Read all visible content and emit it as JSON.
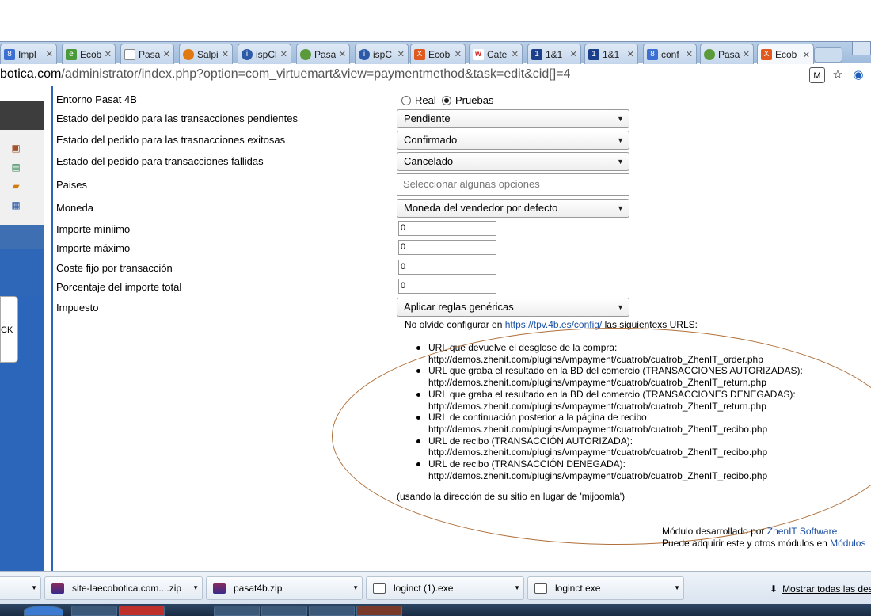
{
  "browser": {
    "tabs": [
      {
        "label": "Impl",
        "icon": "google-icon",
        "color": "#3b6fd1",
        "glyph": "8"
      },
      {
        "label": "Ecob",
        "icon": "eco-icon",
        "color": "#4a9a3a",
        "glyph": "e"
      },
      {
        "label": "Pasa",
        "icon": "page-icon",
        "color": "#999999",
        "glyph": ""
      },
      {
        "label": "Salpi",
        "icon": "fire-icon",
        "color": "#e07a10",
        "glyph": ""
      },
      {
        "label": "ispCl",
        "icon": "isp-icon",
        "color": "#2d5aa8",
        "glyph": "i"
      },
      {
        "label": "Pasa",
        "icon": "leaf-icon",
        "color": "#5a9a3a",
        "glyph": ""
      },
      {
        "label": "ispC",
        "icon": "isp-icon",
        "color": "#2d5aa8",
        "glyph": "i"
      },
      {
        "label": "Ecob",
        "icon": "joomla-icon",
        "color": "#e05a20",
        "glyph": "X"
      },
      {
        "label": "Cate",
        "icon": "w-icon",
        "color": "#d02020",
        "glyph": "w"
      },
      {
        "label": "1&1",
        "icon": "oneandone-icon",
        "color": "#1b3f8a",
        "glyph": "1"
      },
      {
        "label": "1&1",
        "icon": "oneandone-icon",
        "color": "#1b3f8a",
        "glyph": "1"
      },
      {
        "label": "conf",
        "icon": "google-icon",
        "color": "#3b6fd1",
        "glyph": "8"
      },
      {
        "label": "Pasa",
        "icon": "leaf-icon",
        "color": "#5a9a3a",
        "glyph": ""
      },
      {
        "label": "Ecob",
        "icon": "joomla-icon",
        "color": "#e05a20",
        "glyph": "X"
      }
    ],
    "url_host": "botica.com",
    "url_path": "/administrator/index.php?option=com_virtuemart&view=paymentmethod&task=edit&cid[]=4"
  },
  "form": {
    "entorno_label": "Entorno Pasat 4B",
    "entorno_real": "Real",
    "entorno_pruebas": "Pruebas",
    "pendientes_label": "Estado del pedido para las transacciones pendientes",
    "pendientes_value": "Pendiente",
    "exitosas_label": "Estado del pedido para las trasnacciones exitosas",
    "exitosas_value": "Confirmado",
    "fallidas_label": "Estado del pedido para transacciones fallidas",
    "fallidas_value": "Cancelado",
    "paises_label": "Paises",
    "paises_placeholder": "Seleccionar algunas opciones",
    "moneda_label": "Moneda",
    "moneda_value": "Moneda del vendedor por defecto",
    "importe_min_label": "Importe míniimo",
    "importe_min_value": "0",
    "importe_max_label": "Importe máximo",
    "importe_max_value": "0",
    "coste_fijo_label": "Coste fijo por transacción",
    "coste_fijo_value": "0",
    "porcentaje_label": "Porcentaje del importe total",
    "porcentaje_value": "0",
    "impuesto_label": "Impuesto",
    "impuesto_value": "Aplicar reglas genéricas"
  },
  "note": {
    "prefix": "No olvide configurar en ",
    "link": "https://tpv.4b.es/config/",
    "suffix": " las siguientexs URLS:",
    "items": [
      {
        "title": "URL que devuelve el desglose de la compra:",
        "url": "http://demos.zhenit.com/plugins/vmpayment/cuatrob/cuatrob_ZhenIT_order.php"
      },
      {
        "title": "URL que graba el resultado en la BD del comercio (TRANSACCIONES AUTORIZADAS):",
        "url": "http://demos.zhenit.com/plugins/vmpayment/cuatrob/cuatrob_ZhenIT_return.php"
      },
      {
        "title": "URL que graba el resultado en la BD del comercio (TRANSACCIONES DENEGADAS):",
        "url": "http://demos.zhenit.com/plugins/vmpayment/cuatrob/cuatrob_ZhenIT_return.php"
      },
      {
        "title": "URL de continuación posterior a la página de recibo:",
        "url": "http://demos.zhenit.com/plugins/vmpayment/cuatrob/cuatrob_ZhenIT_recibo.php"
      },
      {
        "title": "URL de recibo (TRANSACCIÓN AUTORIZADA):",
        "url": "http://demos.zhenit.com/plugins/vmpayment/cuatrob/cuatrob_ZhenIT_recibo.php"
      },
      {
        "title": "URL de recibo (TRANSACCIÓN DENEGADA):",
        "url": "http://demos.zhenit.com/plugins/vmpayment/cuatrob/cuatrob_ZhenIT_recibo.php"
      }
    ],
    "using": "(usando la dirección de su sitio en lugar de 'mijoomla')"
  },
  "credits": {
    "line1_prefix": "Módulo desarrollado por ",
    "line1_link": "ZhenIT Software",
    "line2_prefix": "Puede adquirir este y otros módulos en ",
    "line2_link": "Módulos"
  },
  "sidebar": {
    "card_text": "CK"
  },
  "downloads": {
    "items": [
      {
        "label": "site-laecobotica.com....zip",
        "icon": "winrar-icon"
      },
      {
        "label": "pasat4b.zip",
        "icon": "winrar-icon"
      },
      {
        "label": "loginct (1).exe",
        "icon": "exe-icon"
      },
      {
        "label": "loginct.exe",
        "icon": "exe-icon"
      }
    ],
    "show_all": "Mostrar todas las des"
  },
  "colors": {
    "accent_blue": "#2b66ba",
    "ellipse": "#b0703a",
    "link": "#1a4fa3"
  }
}
